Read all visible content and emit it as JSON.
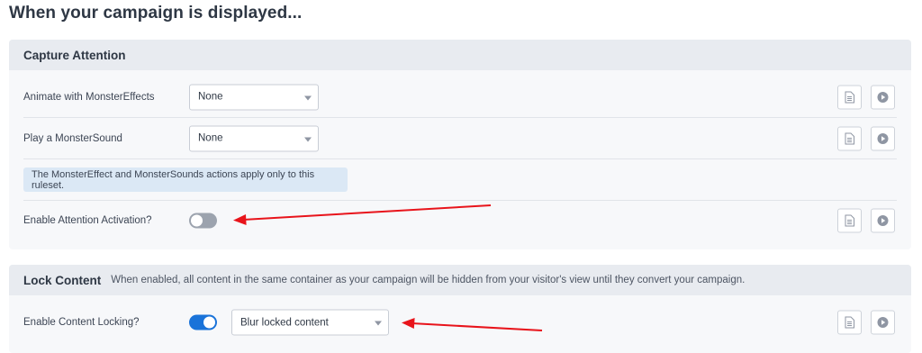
{
  "page": {
    "title": "When your campaign is displayed..."
  },
  "capture": {
    "title": "Capture Attention",
    "rows": [
      {
        "label": "Animate with MonsterEffects",
        "value": "None"
      },
      {
        "label": "Play a MonsterSound",
        "value": "None"
      }
    ],
    "info": "The MonsterEffect and MonsterSounds actions apply only to this ruleset.",
    "activation": {
      "label": "Enable Attention Activation?",
      "enabled": false
    }
  },
  "lock": {
    "title": "Lock Content",
    "description": "When enabled, all content in the same container as your campaign will be hidden from your visitor's view until they convert your campaign.",
    "row": {
      "label": "Enable Content Locking?",
      "enabled": true,
      "value": "Blur locked content"
    }
  },
  "icons": {
    "doc": "document-icon",
    "play": "play-icon",
    "caret": "chevron-down-icon"
  },
  "colors": {
    "accent": "#1a73d9",
    "annotation": "#e8141b",
    "info_bg": "#dbe8f5"
  }
}
